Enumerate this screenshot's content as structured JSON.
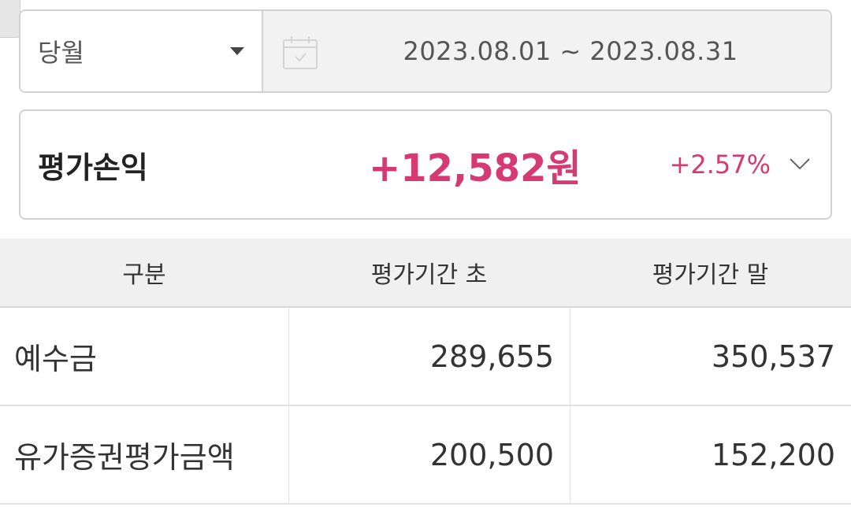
{
  "period": {
    "selected": "당월",
    "date_range": "2023.08.01 ~ 2023.08.31"
  },
  "profit_loss": {
    "label": "평가손익",
    "amount": "+12,582원",
    "rate": "+2.57%"
  },
  "table": {
    "headers": [
      "구분",
      "평가기간 초",
      "평가기간 말"
    ],
    "rows": [
      {
        "name": "예수금",
        "start": "289,655",
        "end": "350,537"
      },
      {
        "name": "유가증권평가금액",
        "start": "200,500",
        "end": "152,200"
      }
    ]
  },
  "colors": {
    "accent": "#d63a72",
    "border": "#d2d2d2",
    "header_bg": "#f0f0f0"
  },
  "icons": [
    "dropdown-caret-icon",
    "calendar-icon",
    "chevron-down-icon"
  ]
}
